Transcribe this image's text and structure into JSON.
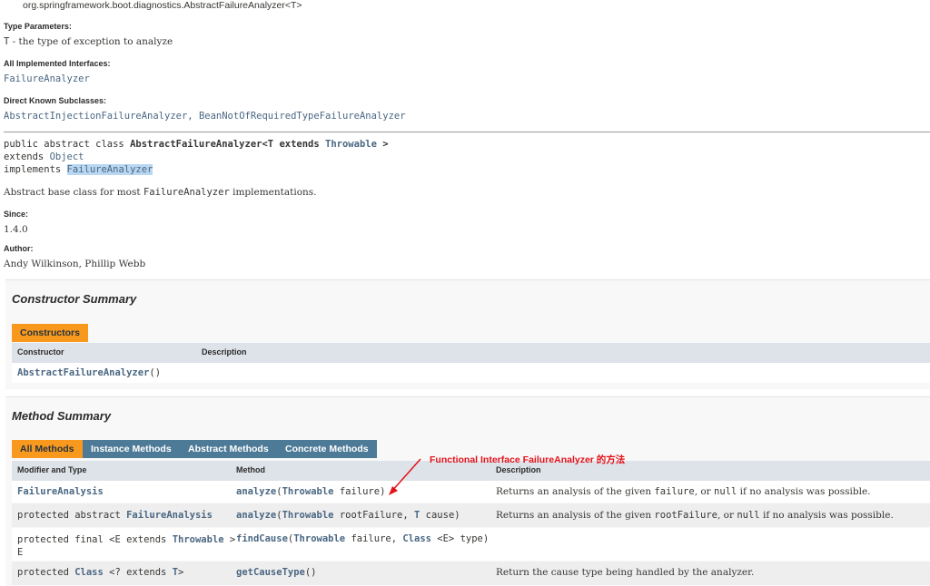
{
  "header": {
    "class_path": "org.springframework.boot.diagnostics.AbstractFailureAnalyzer<T>",
    "type_params_label": "Type Parameters:",
    "type_param_name": "T",
    "type_param_desc": " - the type of exception to analyze",
    "interfaces_label": "All Implemented Interfaces:",
    "interface": "FailureAnalyzer",
    "subclasses_label": "Direct Known Subclasses:",
    "subclass_1": "AbstractInjectionFailureAnalyzer",
    "subclass_sep": ", ",
    "subclass_2": "BeanNotOfRequiredTypeFailureAnalyzer"
  },
  "signature": {
    "prefix": "public abstract class ",
    "class_decl": "AbstractFailureAnalyzer<T extends ",
    "bound": "Throwable",
    "suffix": " >",
    "extends_kw": "extends ",
    "extends_cls": "Object",
    "implements_kw": "implements ",
    "implements_cls": "FailureAnalyzer"
  },
  "description": {
    "pre": "Abstract base class for most ",
    "code": "FailureAnalyzer",
    "post": " implementations.",
    "since_label": "Since:",
    "since_value": "1.4.0",
    "author_label": "Author:",
    "author_value": "Andy Wilkinson, Phillip Webb"
  },
  "constructor_summary": {
    "title": "Constructor Summary",
    "tab": "Constructors",
    "col_constructor": "Constructor",
    "col_description": "Description",
    "row_name": "AbstractFailureAnalyzer",
    "row_args": "()"
  },
  "method_summary": {
    "title": "Method Summary",
    "tabs": [
      "All Methods",
      "Instance Methods",
      "Abstract Methods",
      "Concrete Methods"
    ],
    "col_modifier": "Modifier and Type",
    "col_method": "Method",
    "col_description": "Description",
    "rows": [
      {
        "mod_pre": "",
        "mod_link": "FailureAnalysis",
        "mod_post": "",
        "m_name": "analyze",
        "m_open": "(",
        "m_type": "Throwable",
        "m_arg": "  failure)",
        "m_type2": "",
        "m_arg2": "",
        "d_pre": "Returns an analysis of the given ",
        "d_code": "failure",
        "d_mid": ", or ",
        "d_code2": "null",
        "d_post": " if no analysis was possible."
      },
      {
        "mod_pre": "protected abstract ",
        "mod_link": "FailureAnalysis",
        "mod_post": "",
        "m_name": "analyze",
        "m_open": "(",
        "m_type": "Throwable",
        "m_arg": " rootFailure, ",
        "m_type2": "T",
        "m_arg2": " cause)",
        "d_pre": "Returns an analysis of the given ",
        "d_code": "rootFailure",
        "d_mid": ", or ",
        "d_code2": "null",
        "d_post": " if no analysis was possible."
      },
      {
        "mod_pre": "protected final <E extends ",
        "mod_link": "Throwable",
        "mod_post": " >",
        "mod_line2": "E",
        "m_name": "findCause",
        "m_open": "(",
        "m_type": "Throwable",
        "m_arg": "  failure, ",
        "m_type2": "Class",
        "m_arg2": " <E> type)",
        "d_pre": "",
        "d_code": "",
        "d_mid": "",
        "d_code2": "",
        "d_post": ""
      },
      {
        "mod_pre": "protected ",
        "mod_link": "Class",
        "mod_post": " <? extends ",
        "mod_link2": "T",
        "mod_post2": ">",
        "m_name": "getCauseType",
        "m_open": "()",
        "m_type": "",
        "m_arg": "",
        "m_type2": "",
        "m_arg2": "",
        "d_pre": "Return the cause type being handled by the analyzer.",
        "d_code": "",
        "d_mid": "",
        "d_code2": "",
        "d_post": ""
      }
    ]
  },
  "annotation": {
    "text": "Functional Interface FailureAnalyzer  的方法",
    "color": "#e3111a"
  },
  "colors": {
    "link": "#4a6782",
    "tab_active": "#f8981d",
    "tab_inactive": "#4d7a97",
    "header_row": "#dee3e9",
    "alt_row": "#eeeeef"
  }
}
